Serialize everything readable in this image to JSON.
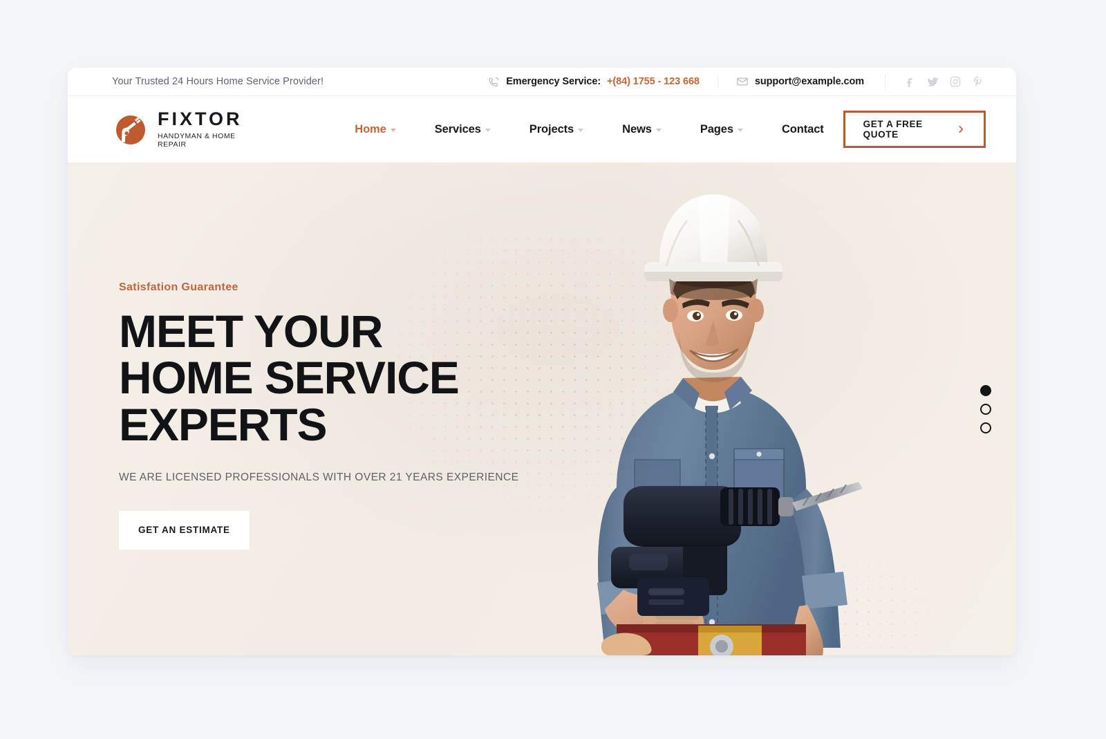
{
  "topbar": {
    "tagline": "Your Trusted 24 Hours Home Service Provider!",
    "phone_icon": "phone-ring-icon",
    "emergency_label": "Emergency Service:",
    "emergency_number": "+(84) 1755 - 123 668",
    "mail_icon": "envelope-icon",
    "email": "support@example.com",
    "socials": [
      {
        "name": "facebook-icon",
        "glyph": "f"
      },
      {
        "name": "twitter-icon",
        "glyph": "t"
      },
      {
        "name": "instagram-icon",
        "glyph": "i"
      },
      {
        "name": "pinterest-icon",
        "glyph": "p"
      }
    ]
  },
  "brand": {
    "logo_icon": "hand-holding-wrench-icon",
    "name": "FIXTOR",
    "tagline": "HANDYMAN & HOME REPAIR"
  },
  "nav": {
    "items": [
      {
        "label": "Home",
        "active": true,
        "caret": true
      },
      {
        "label": "Services",
        "active": false,
        "caret": true
      },
      {
        "label": "Projects",
        "active": false,
        "caret": true
      },
      {
        "label": "News",
        "active": false,
        "caret": true
      },
      {
        "label": "Pages",
        "active": false,
        "caret": true
      },
      {
        "label": "Contact",
        "active": false,
        "caret": false
      }
    ],
    "cta_label": "GET A FREE QUOTE",
    "cta_icon": "chevron-right-icon"
  },
  "hero": {
    "eyebrow": "Satisfation Guarantee",
    "title_line1": "MEET YOUR",
    "title_line2": "HOME SERVICE",
    "title_line3": "EXPERTS",
    "subtitle": "WE ARE LICENSED PROFESSIONALS WITH OVER 21 YEARS EXPERIENCE",
    "button_label": "GET AN ESTIMATE",
    "image_alt": "smiling-handyman-in-white-hard-hat-holding-cordless-drill",
    "slider": {
      "total": 3,
      "active_index": 0
    }
  },
  "colors": {
    "accent": "#c4643a",
    "accent_border": "#b75b31",
    "ink": "#17191e",
    "hero_bg": "#f4efe8",
    "page_bg": "#f3f5f9",
    "muted": "#5f6470"
  }
}
